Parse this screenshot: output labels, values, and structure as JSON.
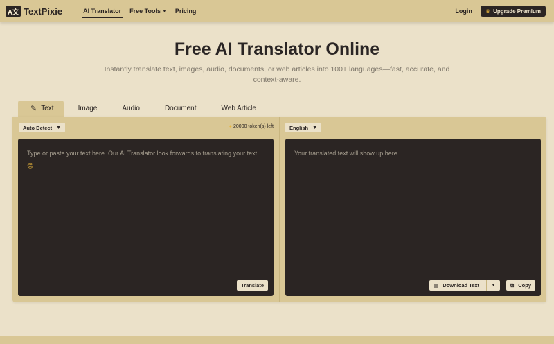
{
  "header": {
    "logo_mark": "A文",
    "logo_text": "TextPixie",
    "nav": [
      {
        "label": "AI Translator",
        "active": true
      },
      {
        "label": "Free Tools",
        "has_dropdown": true
      },
      {
        "label": "Pricing"
      }
    ],
    "login_label": "Login",
    "upgrade_label": "Upgrade Premium",
    "upgrade_icon": "crown-icon"
  },
  "hero": {
    "title": "Free AI Translator Online",
    "subtitle": "Instantly translate text, images, audio, documents, or web articles into 100+ languages—fast, accurate, and context-aware."
  },
  "tabs": [
    {
      "label": "Text",
      "active": true,
      "icon": "pen-icon"
    },
    {
      "label": "Image"
    },
    {
      "label": "Audio"
    },
    {
      "label": "Document"
    },
    {
      "label": "Web Article"
    }
  ],
  "source": {
    "language": "Auto Detect",
    "tokens": "20000 token(s) left",
    "placeholder": "Type or paste your text here. Our AI Translator look forwards to translating your text",
    "emoji": "😊",
    "translate_label": "Translate"
  },
  "target": {
    "language": "English",
    "placeholder": "Your translated text will show up here...",
    "download_label": "Download Text",
    "copy_label": "Copy"
  },
  "colors": {
    "background": "#ebe1c9",
    "panel": "#d9c795",
    "dark": "#2b2523",
    "accent": "#e7b43b"
  }
}
